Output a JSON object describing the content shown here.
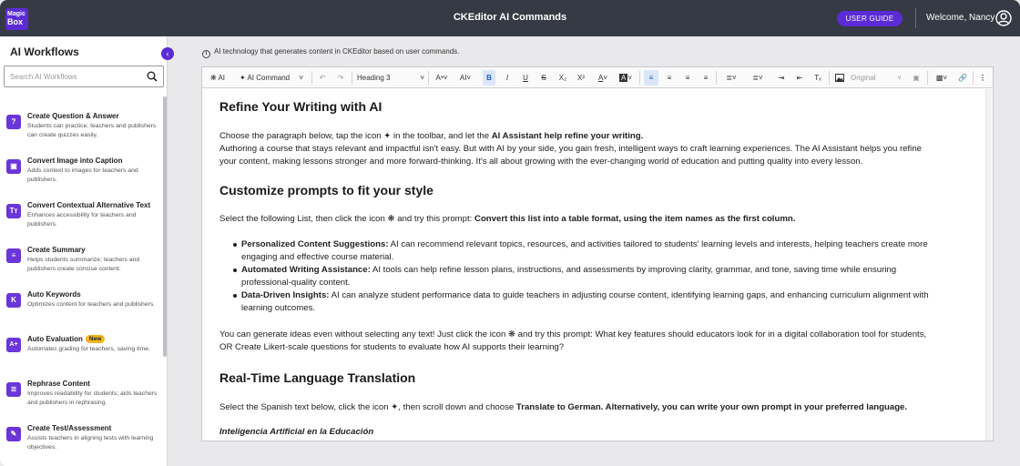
{
  "header": {
    "logo_line1": "Magic",
    "logo_line2": "Box",
    "title": "CKEditor AI Commands",
    "user_guide": "USER GUIDE",
    "welcome": "Welcome, Nancy"
  },
  "sidebar": {
    "title": "AI Workflows",
    "search_placeholder": "Search AI Workflows",
    "items": [
      {
        "icon": "question-icon",
        "glyph": "?",
        "name": "Create Question & Answer",
        "desc": "Students can practice; teachers and publishers can create quizzes easily."
      },
      {
        "icon": "image-caption-icon",
        "glyph": "▣",
        "name": "Convert Image into Caption",
        "desc": "Adds context to images for teachers and publishers."
      },
      {
        "icon": "text-alt-icon",
        "glyph": "Tт",
        "name": "Convert Contextual Alternative Text",
        "desc": "Enhances accessibility for teachers and publishers."
      },
      {
        "icon": "summary-icon",
        "glyph": "≡",
        "name": "Create Summary",
        "desc": "Helps students summarize; teachers and publishers create concise content."
      },
      {
        "icon": "keywords-icon",
        "glyph": "K",
        "name": "Auto Keywords",
        "desc": "Optimizes content for teachers and publishers."
      },
      {
        "icon": "evaluation-icon",
        "glyph": "A+",
        "name": "Auto Evaluation",
        "badge": "New",
        "desc": "Automates grading for teachers, saving time."
      },
      {
        "icon": "rephrase-icon",
        "glyph": "≣",
        "name": "Rephrase Content",
        "desc": "Improves readability for students; aids teachers and publishers in rephrasing."
      },
      {
        "icon": "test-icon",
        "glyph": "✎",
        "name": "Create Test/Assessment",
        "desc": "Assists teachers in aligning tests with learning objectives."
      }
    ]
  },
  "main": {
    "info": "AI technology that generates content in CKEditor based on user commands."
  },
  "toolbar": {
    "ai_label": "AI",
    "ai_command_label": "AI Command",
    "heading_value": "Heading 3",
    "image_style_value": "Original"
  },
  "doc": {
    "h1": "Refine Your Writing with AI",
    "p1_a": "Choose the paragraph below, tap the icon ",
    "p1_b": " in the toolbar, and let the ",
    "p1_c": "AI Assistant help refine your writing.",
    "p2_l1": "Authoring a course that stays relevant and impactful isn't easy. But with AI by your side, you gain fresh, intelligent ways to craft learning experiences. The AI Assistant helps you refine",
    "p2_l2": "your content, making lessons stronger and more forward-thinking. It's all about growing with the ever-changing world of education and putting quality into every lesson.",
    "h2": "Customize prompts to fit your style",
    "p3_a": "Select the following List, then click the icon ",
    "p3_b": " and try this prompt: ",
    "p3_c": "Convert this list into a table format, using the item names as the first column.",
    "bullets": [
      {
        "title": "Personalized Content Suggestions:",
        "l1": " AI can recommend relevant topics, resources, and activities tailored to students' learning levels and interests, helping teachers create more",
        "l2": "engaging and effective course material."
      },
      {
        "title": "Automated Writing Assistance:",
        "l1": " AI tools can help refine lesson plans, instructions, and assessments by improving clarity, grammar, and tone, saving time while ensuring",
        "l2": "professional-quality content."
      },
      {
        "title": "Data-Driven Insights:",
        "l1": " AI can analyze student performance data to guide teachers in adjusting course content, identifying learning gaps, and enhancing curriculum alignment with",
        "l2": "learning outcomes."
      }
    ],
    "p4_a": "You can generate ideas even without selecting any text! Just click the icon ",
    "p4_b": " and try this prompt: What key features should educators look for in a digital collaboration tool for students,",
    "p4_l2": "OR Create Likert-scale questions for students to evaluate how AI supports their learning?",
    "h3": "Real-Time Language Translation",
    "p5_a": "Select the Spanish text below, click the icon ",
    "p5_b": ", then scroll down and choose ",
    "p5_c": "Translate to German. Alternatively, you can write your own prompt in your preferred language.",
    "spanish_title": "Inteligencia Artificial en la Educación"
  },
  "colors": {
    "accent": "#5b2bd6",
    "header_bg": "#353a44",
    "prompt_purple": "#7a3aa6",
    "badge": "#f2b51f"
  }
}
